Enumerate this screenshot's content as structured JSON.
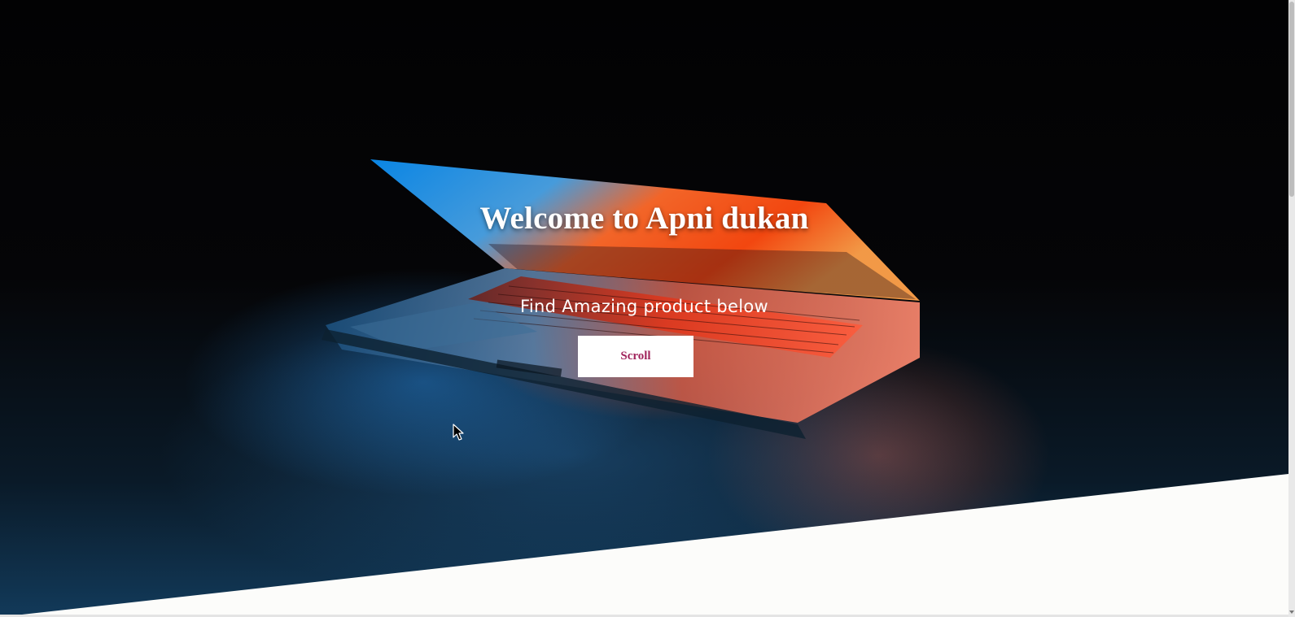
{
  "hero": {
    "title": "Welcome to Apni dukan",
    "subtitle": "Find Amazing product below",
    "scroll_button_label": "Scroll",
    "background_image": "laptop-glow-photo"
  },
  "colors": {
    "title_text": "#ffffff",
    "button_text": "#a0245c",
    "button_background": "#ffffff",
    "page_background": "#fcfcfa"
  },
  "icons": {
    "cursor": "mouse-pointer-icon"
  }
}
